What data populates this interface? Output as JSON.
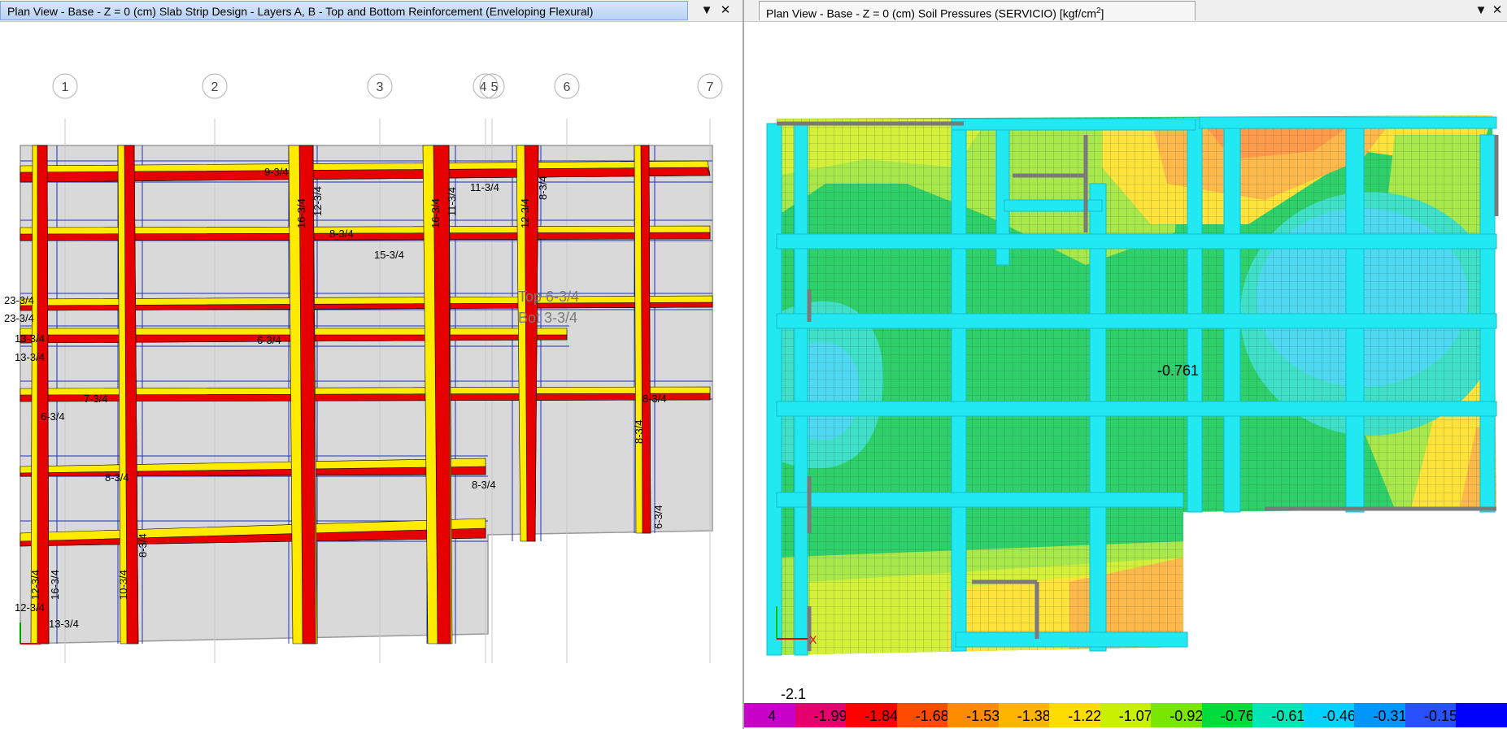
{
  "left_window": {
    "title": "Plan View - Base - Z = 0 (cm)  Slab Strip Design - Layers A, B - Top and Bottom Reinforcement (Enveloping Flexural)",
    "dropdown_icon": "chevron-down-icon",
    "close_icon": "close-icon",
    "grid_bubbles": [
      "1",
      "2",
      "3",
      "4",
      "5",
      "6",
      "7"
    ],
    "strip_labels": [
      "9-3/4",
      "8-3/4",
      "15-3/4",
      "11-3/4",
      "16-3/4",
      "12-3/4",
      "16-3/4",
      "11-3/4",
      "12-3/4",
      "8-3/4",
      "23-3/4",
      "23-3/4",
      "13-3/4",
      "13-3/4",
      "6-3/4",
      "7-3/4",
      "6-3/4",
      "8-3/4",
      "8-3/4",
      "8-3/4",
      "8-3/4",
      "6-3/4",
      "10-3/4",
      "8-3/4",
      "12-3/4",
      "12-3/4",
      "13-3/4",
      "16-3/4"
    ],
    "tooltip": {
      "line1": "Top 6-3/4",
      "line2": "Bot 3-3/4"
    }
  },
  "right_window": {
    "title_main": "Plan View - Base - Z = 0 (cm)    Soil Pressures    (SERVICIO)  [kgf/cm",
    "title_sup": "2",
    "title_end": "]",
    "dropdown_icon": "chevron-down-icon",
    "close_icon": "close-icon",
    "annotation": "-0.761",
    "axis_x_label": "X"
  },
  "legend": {
    "min_label": "-2.1",
    "items": [
      {
        "label": "4",
        "color": "#c800c8"
      },
      {
        "label": "-1.99",
        "color": "#e6006e"
      },
      {
        "label": "-1.84",
        "color": "#ff0000"
      },
      {
        "label": "-1.68",
        "color": "#ff4b00"
      },
      {
        "label": "-1.53",
        "color": "#ff8c00"
      },
      {
        "label": "-1.38",
        "color": "#ffb400"
      },
      {
        "label": "-1.22",
        "color": "#ffdc00"
      },
      {
        "label": "-1.07",
        "color": "#c8f000"
      },
      {
        "label": "-0.92",
        "color": "#78e600"
      },
      {
        "label": "-0.76",
        "color": "#00dc3c"
      },
      {
        "label": "-0.61",
        "color": "#00e6b4"
      },
      {
        "label": "-0.46",
        "color": "#00d2ff"
      },
      {
        "label": "-0.31",
        "color": "#0096ff"
      },
      {
        "label": "-0.15",
        "color": "#2850ff"
      },
      {
        "label": "",
        "color": "#0000ff"
      }
    ]
  }
}
